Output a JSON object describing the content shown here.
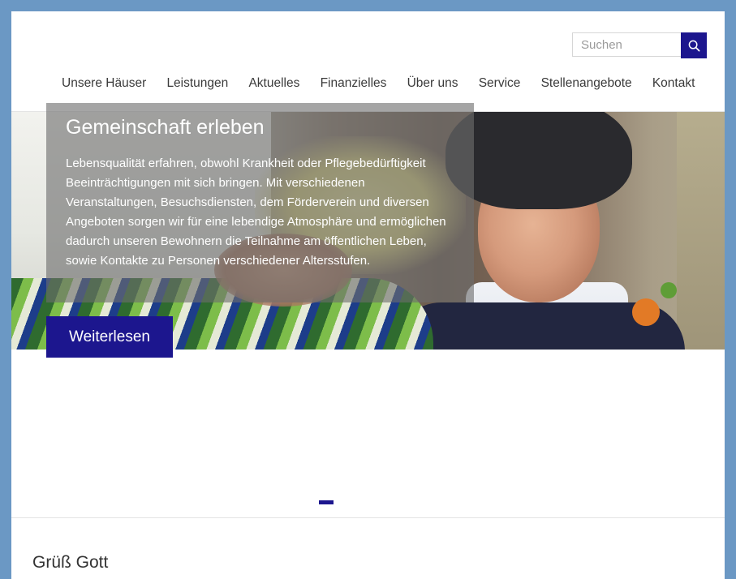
{
  "search": {
    "placeholder": "Suchen",
    "button_icon": "search-icon"
  },
  "nav": {
    "items": [
      {
        "label": "Unsere Häuser"
      },
      {
        "label": "Leistungen"
      },
      {
        "label": "Aktuelles"
      },
      {
        "label": "Finanzielles"
      },
      {
        "label": "Über uns"
      },
      {
        "label": "Service"
      },
      {
        "label": "Stellenangebote"
      },
      {
        "label": "Kontakt"
      }
    ]
  },
  "slider": {
    "title": "Gemeinschaft erleben",
    "text": "Lebensqualität erfahren, obwohl Krankheit oder Pflegebedürftigkeit Beeinträchtigungen mit sich bringen. Mit verschiedenen Veranstaltungen, Besuchsdiensten, dem Förderverein und diversen Angeboten sorgen wir für eine lebendige Atmosphäre und ermöglichen dadurch unseren Bewohnern die Teilnahme am öffentlichen Leben, sowie Kontakte zu Personen verschiedener Altersstufen.",
    "button_label": "Weiterlesen"
  },
  "content": {
    "heading": "Grüß Gott"
  },
  "colors": {
    "accent": "#1c168e",
    "frame": "#6b98c4"
  }
}
